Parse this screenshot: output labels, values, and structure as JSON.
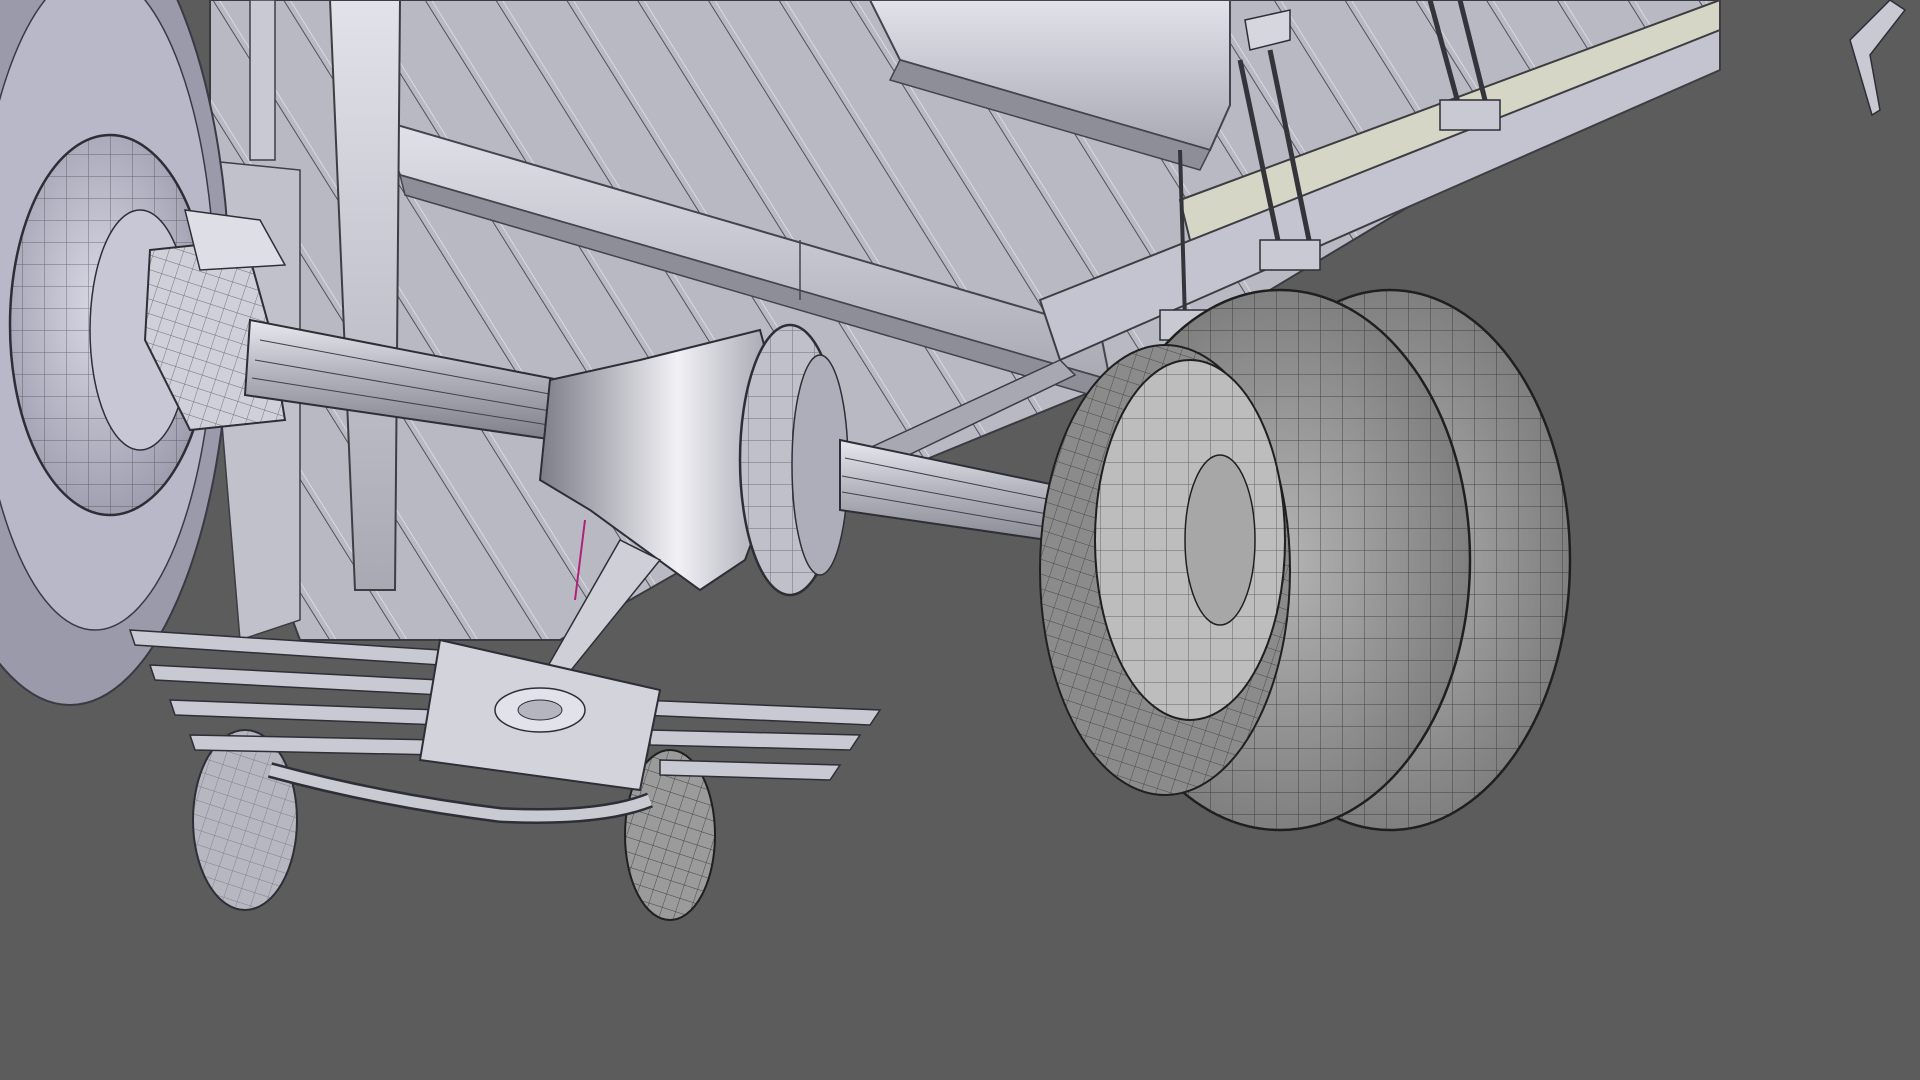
{
  "viewport": {
    "background_color": "#5c5c5c",
    "render_mode": "solid-with-wireframe-overlay",
    "mesh_color": "#c9c9d2",
    "wire_color": "#2a2a2a",
    "selected_edge_color": "#b0207a"
  },
  "scene": {
    "subject": "vehicle-undercarriage",
    "parts": [
      "cargo-bed-floor",
      "bed-crossmembers",
      "chassis-rail-left",
      "chassis-rail-right",
      "rear-axle-housing",
      "differential-housing",
      "drum-brake-left",
      "wheel-left",
      "dual-rear-wheel-right",
      "leaf-spring-u-bolts",
      "front-spare-tire",
      "small-caster-wheel",
      "cooling-fin-plates",
      "exhaust-pipe"
    ]
  }
}
